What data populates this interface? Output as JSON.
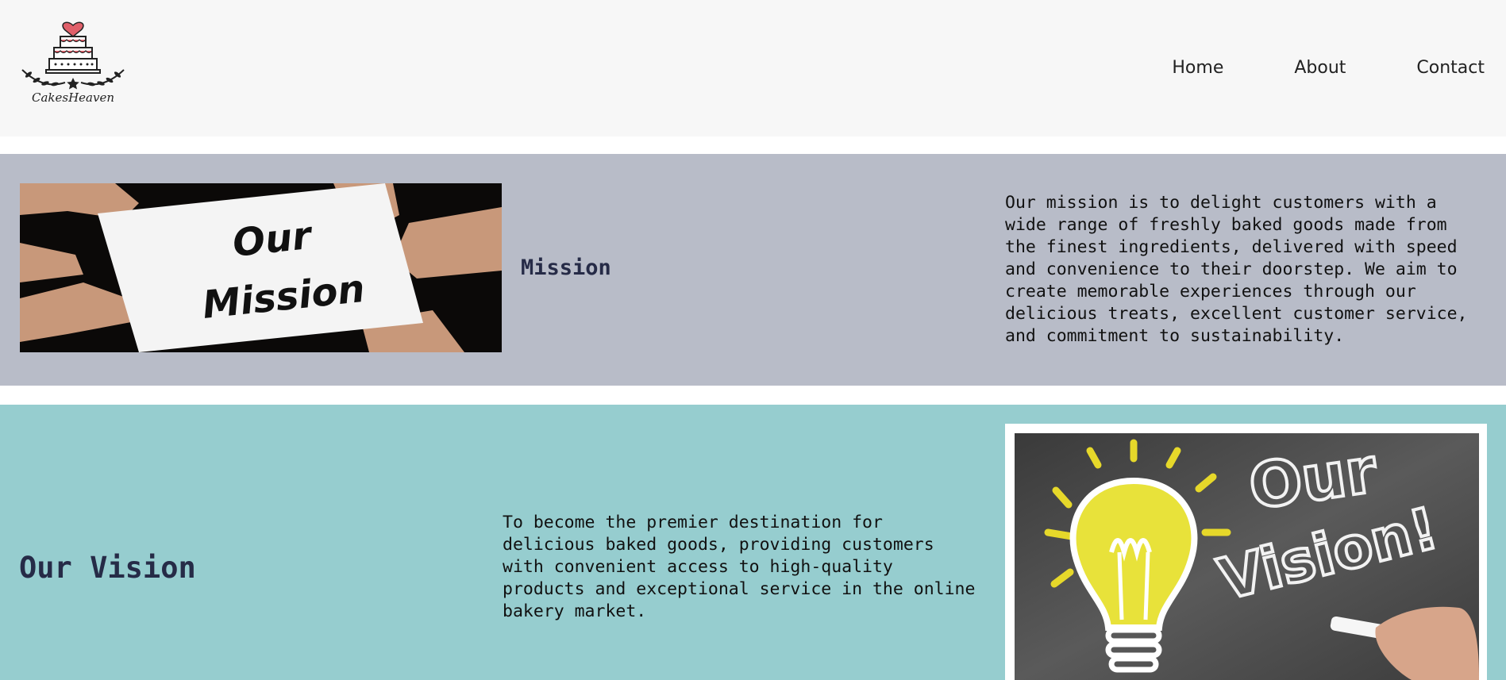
{
  "header": {
    "brand": "CakesHeaven",
    "nav": [
      "Home",
      "About",
      "Contact"
    ]
  },
  "mission": {
    "image_text_line1": "Our",
    "image_text_line2": "Mission",
    "title": "Mission",
    "text": "Our mission is to delight customers with a wide range of freshly baked goods made from the finest ingredients, delivered with speed and convenience to their doorstep. We aim to create memorable experiences through our delicious treats, excellent customer service, and commitment to sustainability."
  },
  "vision": {
    "title": "Our Vision",
    "text": "To become the premier destination for delicious baked goods, providing customers with convenient access to high-quality products and exceptional service in the online bakery market.",
    "image_text_line1": "Our",
    "image_text_line2": "Vision!"
  },
  "colors": {
    "header_bg": "#f7f7f7",
    "mission_bg": "#b8bcc8",
    "vision_bg": "#96cdcf",
    "heading": "#262b47",
    "logo_accent": "#e0606a"
  },
  "icons": [
    "cake-logo-icon",
    "laurel-icon",
    "lightbulb-icon"
  ]
}
